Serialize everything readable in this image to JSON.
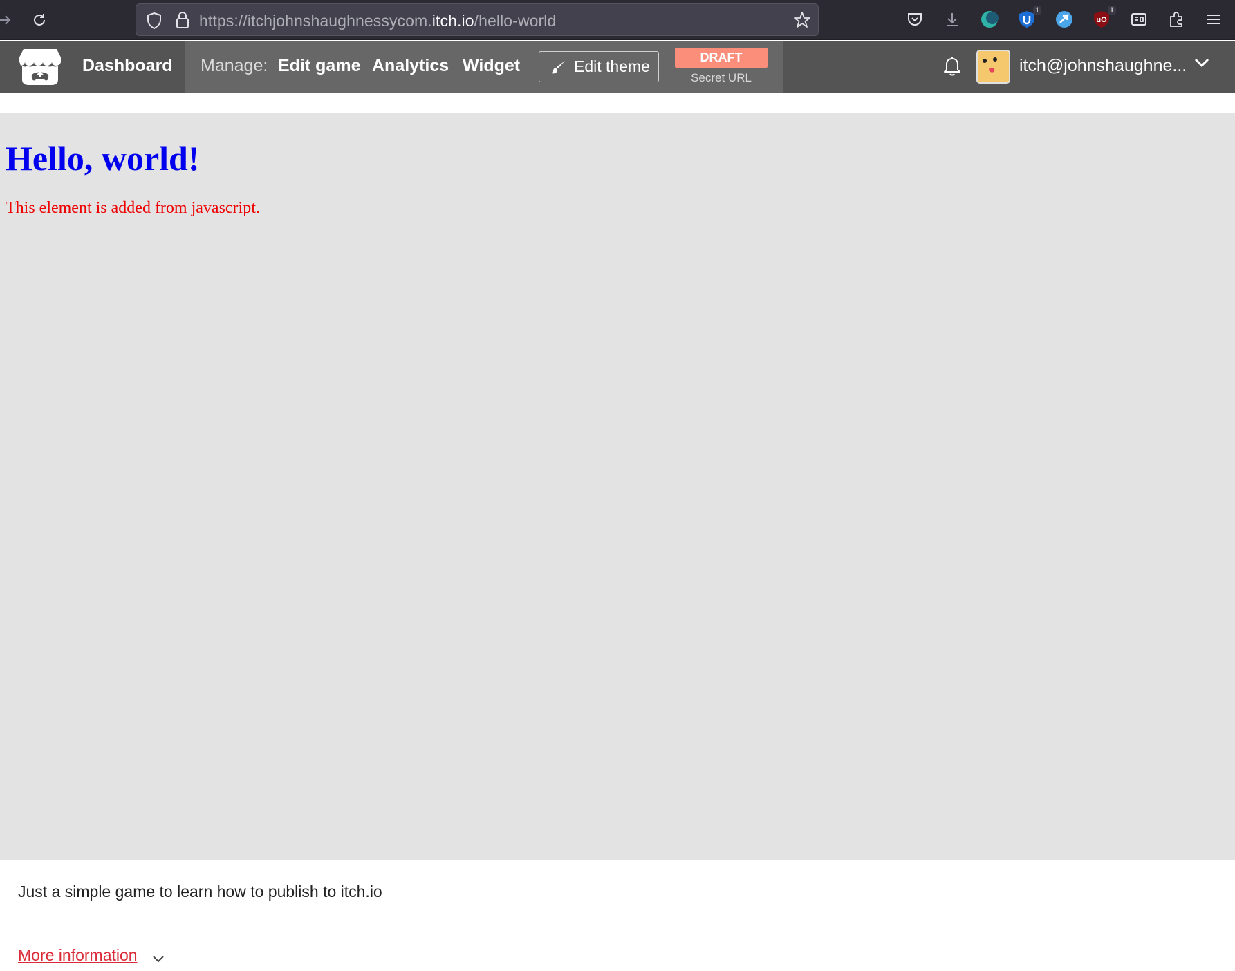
{
  "browser": {
    "url_prefix": "https://itchjohnshaughnessycom.",
    "url_host": "itch.io",
    "url_path": "/hello-world",
    "extension_badges": [
      "1",
      "1"
    ]
  },
  "header": {
    "dashboard_label": "Dashboard",
    "manage_label": "Manage:",
    "edit_game_label": "Edit game",
    "analytics_label": "Analytics",
    "widget_label": "Widget",
    "edit_theme_label": "Edit theme",
    "draft_label": "DRAFT",
    "secret_url_label": "Secret URL",
    "user_name": "itch@johnshaughne..."
  },
  "game": {
    "title": "Hello, world!",
    "text": "This element is added from javascript."
  },
  "page": {
    "description": "Just a simple game to learn how to publish to itch.io",
    "more_info_label": "More information"
  },
  "colors": {
    "header_bg": "#545454",
    "manage_bg": "#676767",
    "draft_bg": "#fa8e7b",
    "game_bg": "#e3e3e3",
    "title_color": "#0000ee",
    "text_color": "#ee0000",
    "link_color": "#da2c38"
  },
  "icons": [
    "forward-icon",
    "reload-icon",
    "shield-icon",
    "lock-icon",
    "bookmark-star-icon",
    "pocket-icon",
    "downloads-icon",
    "extension-moon-icon",
    "extension-shield-icon",
    "extension-bird-icon",
    "ublock-icon",
    "reader-icon",
    "extensions-puzzle-icon",
    "menu-icon",
    "itch-logo-icon",
    "brush-icon",
    "bell-icon",
    "chevron-down-icon"
  ]
}
